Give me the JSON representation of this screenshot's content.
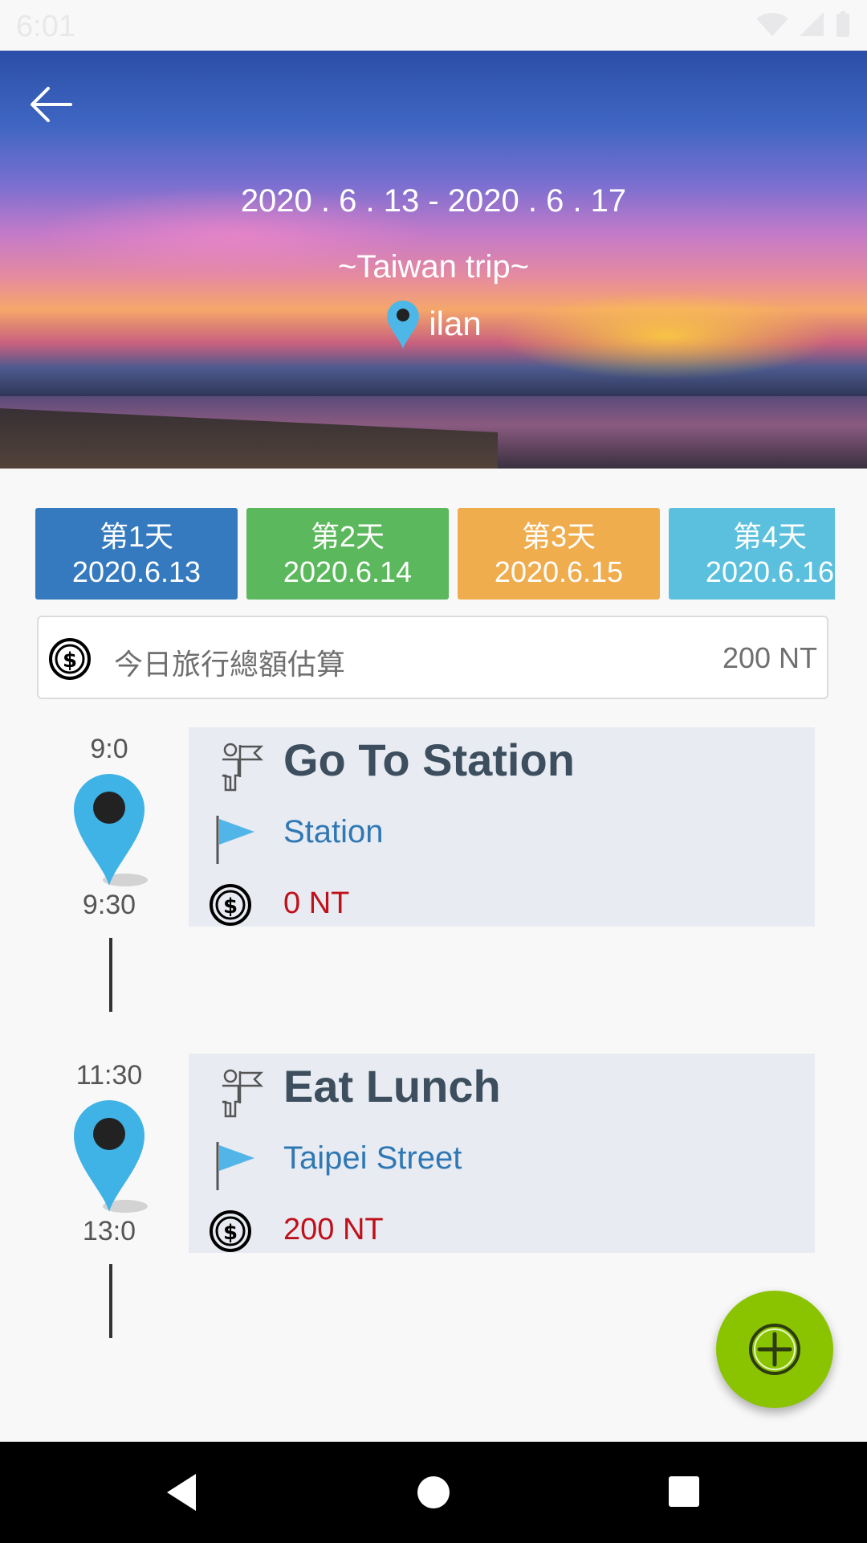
{
  "status_bar": {
    "time": "6:01"
  },
  "header": {
    "date_range": "2020 . 6 . 13 - 2020 . 6 . 17",
    "trip_name": "~Taiwan trip~",
    "location": "ilan"
  },
  "day_tabs": [
    {
      "day": "第1天",
      "date": "2020.6.13",
      "color": "#357abe"
    },
    {
      "day": "第2天",
      "date": "2020.6.14",
      "color": "#5cb85c"
    },
    {
      "day": "第3天",
      "date": "2020.6.15",
      "color": "#f0ad4e"
    },
    {
      "day": "第4天",
      "date": "2020.6.16",
      "color": "#5bc0de"
    }
  ],
  "budget": {
    "label": "今日旅行總額估算",
    "amount": "200 NT"
  },
  "events": [
    {
      "start": "9:0",
      "end": "9:30",
      "title": "Go To Station",
      "place": "Station",
      "cost": "0 NT"
    },
    {
      "start": "11:30",
      "end": "13:0",
      "title": "Eat Lunch",
      "place": "Taipei Street",
      "cost": "200 NT"
    }
  ],
  "colors": {
    "fab": "#8ac400",
    "cost": "#c0101a",
    "place": "#2f78b4"
  },
  "icons": [
    "back-arrow-icon",
    "map-pin-icon",
    "coin-icon",
    "person-flag-icon",
    "flag-icon",
    "add-circle-icon"
  ]
}
